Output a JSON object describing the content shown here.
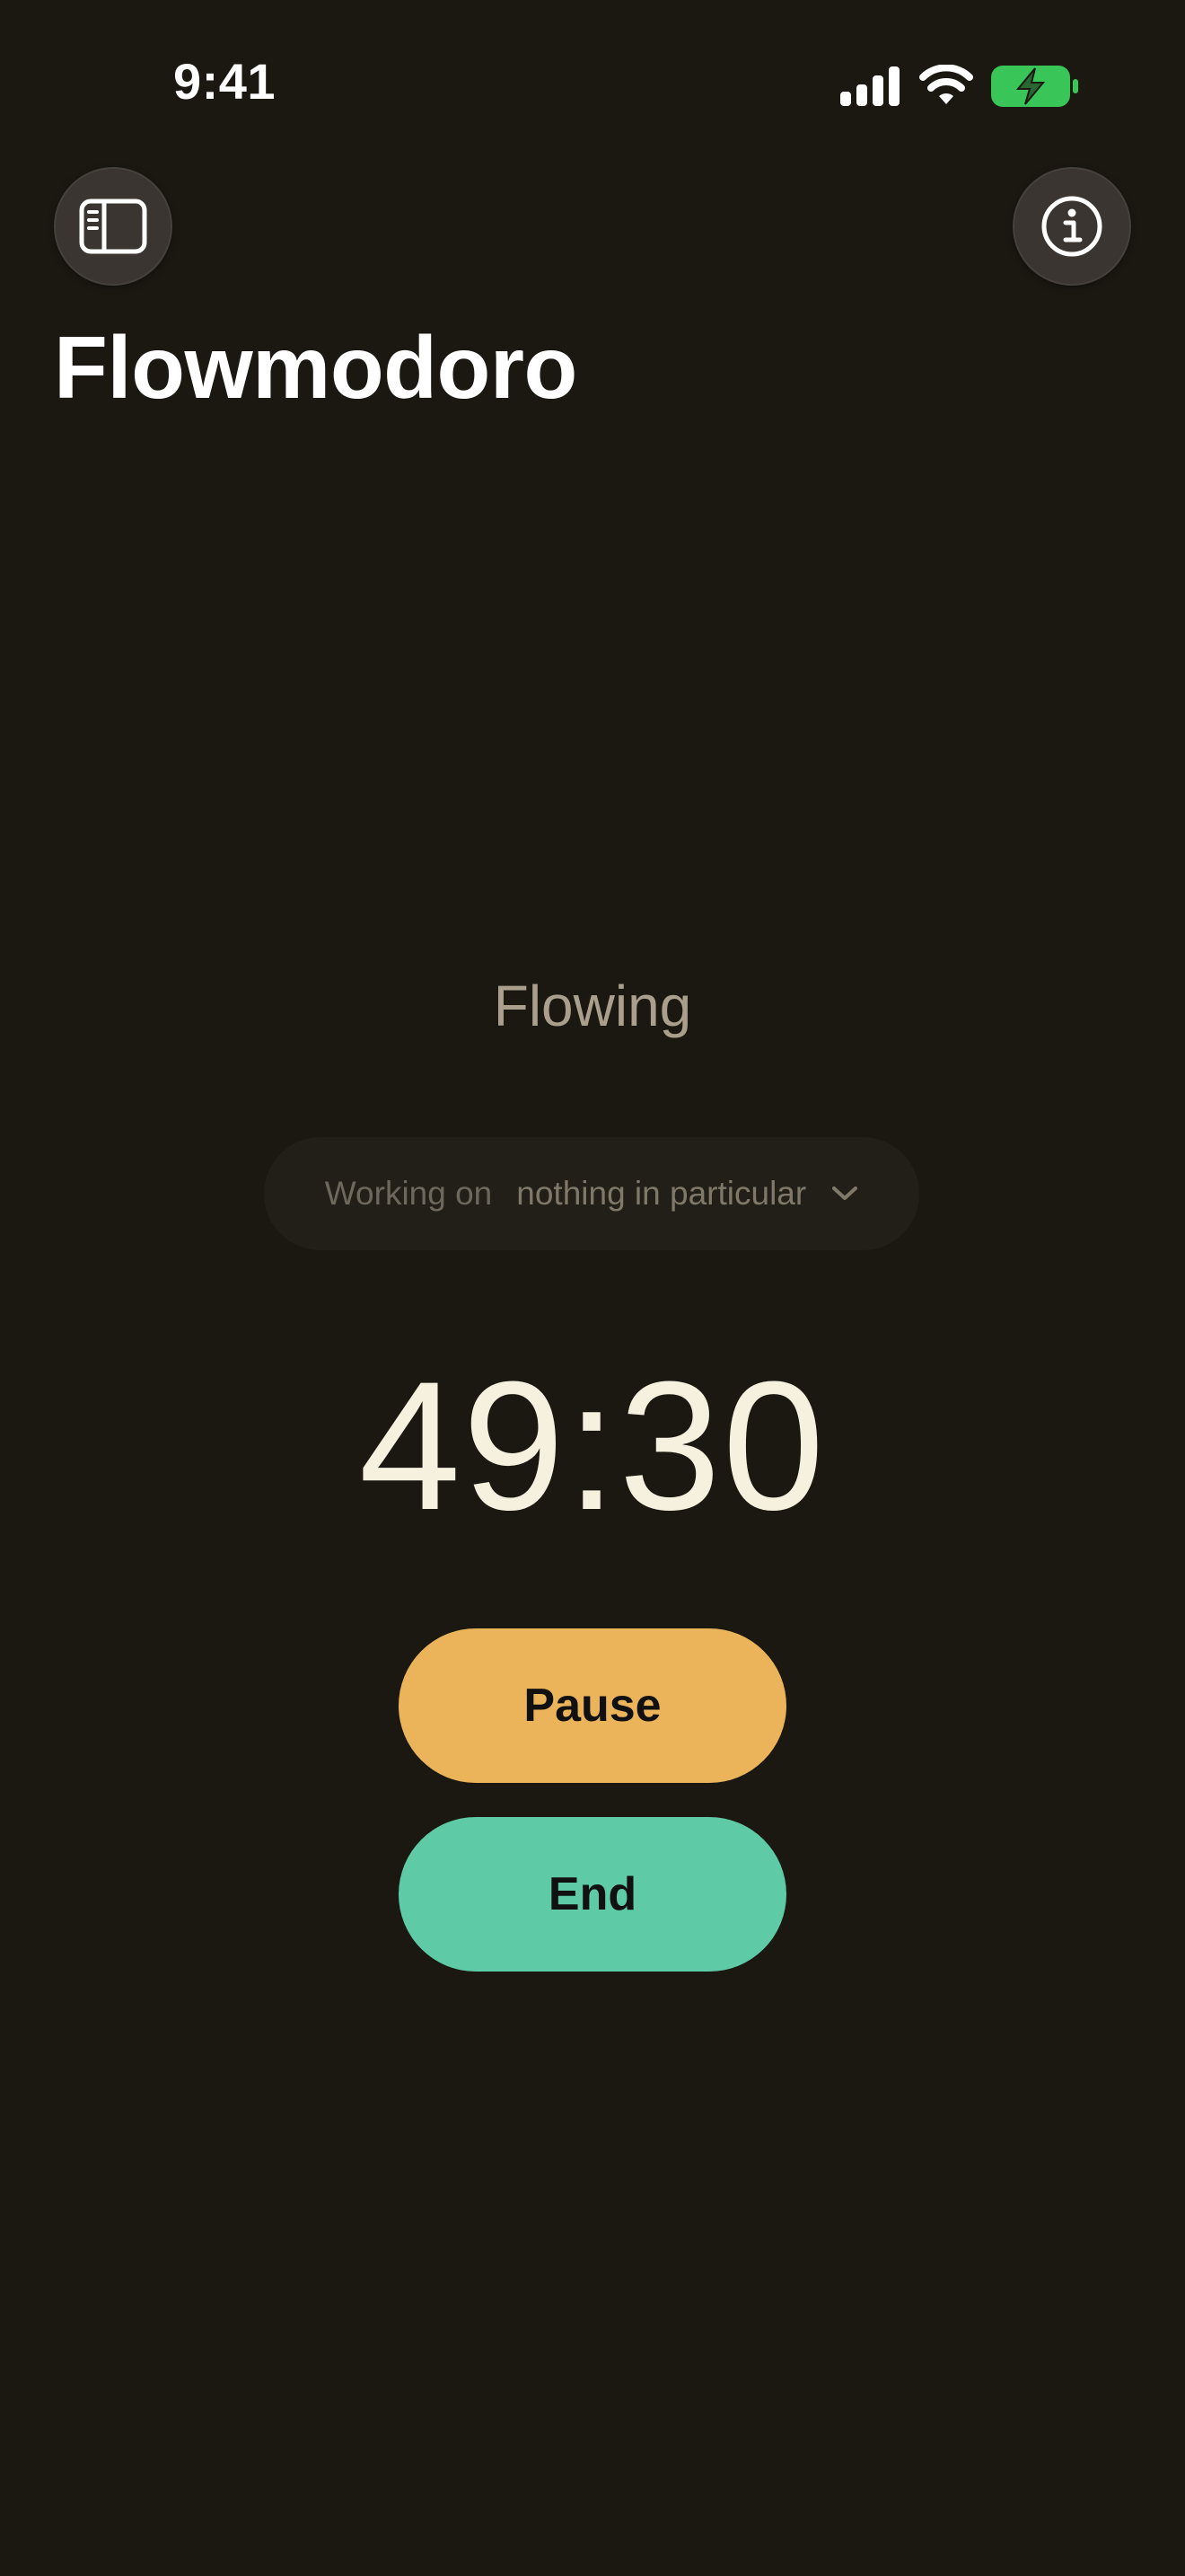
{
  "status_bar": {
    "time": "9:41",
    "icons": [
      "signal-icon",
      "wifi-icon",
      "battery-charging-icon"
    ],
    "battery_color": "#3ac559"
  },
  "nav": {
    "left_icon": "sidebar-icon",
    "right_icon": "info-icon"
  },
  "header": {
    "title": "Flowmodoro"
  },
  "main": {
    "state": "Flowing",
    "task_picker": {
      "prefix": "Working on",
      "value": "nothing in particular",
      "icon": "chevron-down-icon"
    },
    "timer": "49:30",
    "buttons": {
      "pause": "Pause",
      "end": "End"
    }
  },
  "colors": {
    "background": "#1b1812",
    "pause": "#ebb45a",
    "end": "#5ecaa6",
    "timer_text": "#f6f0df",
    "state_text": "#a99f8c"
  }
}
